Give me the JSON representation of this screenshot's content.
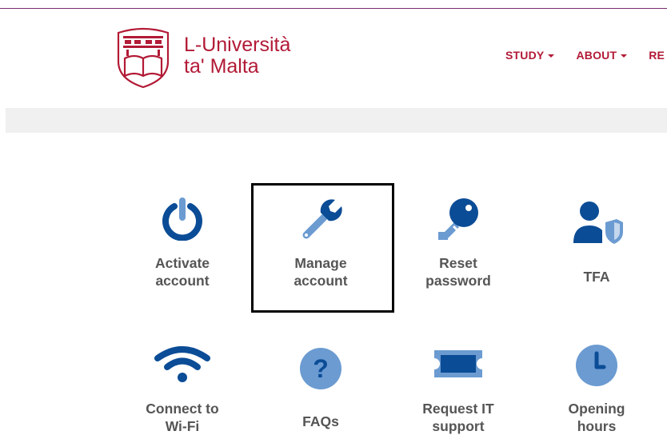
{
  "header": {
    "logo_line1": "L-Università",
    "logo_line2": "ta' Malta",
    "nav": [
      {
        "label": "STUDY"
      },
      {
        "label": "ABOUT"
      },
      {
        "label": "RE"
      }
    ]
  },
  "tiles": [
    {
      "line1": "Activate",
      "line2": "account",
      "icon": "power-icon"
    },
    {
      "line1": "Manage",
      "line2": "account",
      "icon": "wrench-icon"
    },
    {
      "line1": "Reset",
      "line2": "password",
      "icon": "key-icon"
    },
    {
      "line1": "TFA",
      "line2": "",
      "icon": "user-shield-icon"
    },
    {
      "line1": "Connect to",
      "line2": "Wi-Fi",
      "icon": "wifi-icon"
    },
    {
      "line1": "FAQs",
      "line2": "",
      "icon": "question-icon"
    },
    {
      "line1": "Request IT",
      "line2": "support",
      "icon": "ticket-icon"
    },
    {
      "line1": "Opening",
      "line2": "hours",
      "icon": "clock-icon"
    }
  ],
  "colors": {
    "brand": "#b21a36",
    "icon_dark": "#0b4c96",
    "icon_light": "#6b9bd1"
  }
}
